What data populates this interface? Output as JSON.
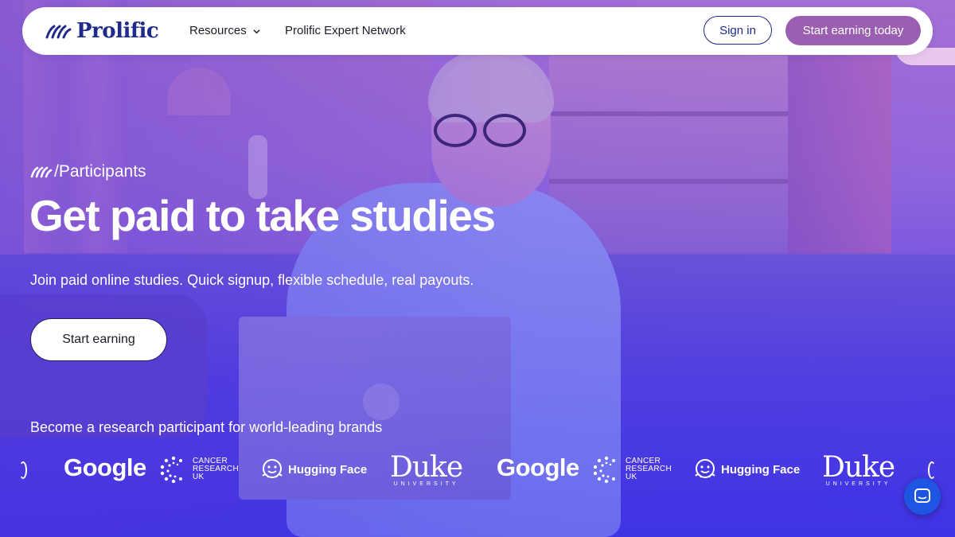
{
  "nav": {
    "logo_text": "Prolific",
    "resources": "Resources",
    "expert_network": "Prolific Expert Network",
    "sign_in": "Sign in",
    "start_earning_today": "Start earning today"
  },
  "hero": {
    "breadcrumb": "/Participants",
    "title": "Get paid to take studies",
    "subtitle": "Join paid online studies. Quick signup, flexible schedule, real payouts.",
    "cta": "Start earning",
    "brands_label": "Become a research participant for world-leading brands"
  },
  "brands": {
    "google": "Google",
    "cancer_research_lines": [
      "CANCER",
      "RESEARCH",
      "UK"
    ],
    "hugging_face": "Hugging Face",
    "duke": "Duke",
    "duke_sub": "UNIVERSITY"
  },
  "icons": {
    "logo": "prolific-fan-icon",
    "chevron": "chevron-down-icon",
    "chat": "chat-icon"
  },
  "colors": {
    "brand_navy": "#1f2a8c",
    "cta_purple": "#9a5fb0",
    "chat_blue": "#1e56e3"
  }
}
